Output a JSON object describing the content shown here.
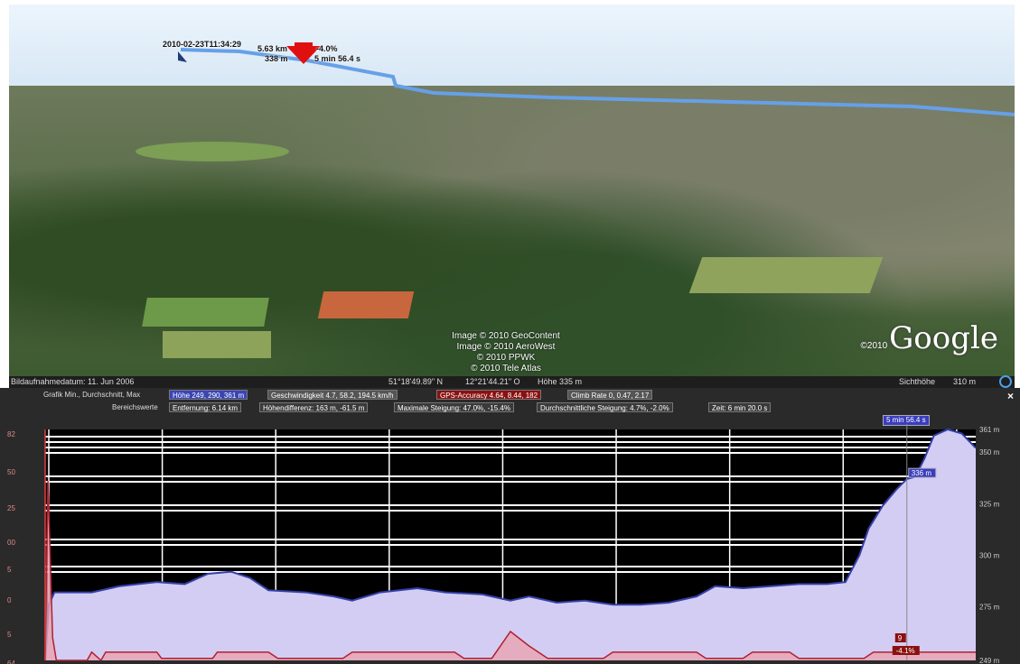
{
  "map": {
    "track_label_time": "2010-02-23T11:34:29",
    "track_label_dist": "5.63 km",
    "track_label_alt": "338 m",
    "track_label_grade": "-4.0%",
    "track_label_dur": "5 min 56.4 s",
    "copyright": [
      "Image © 2010 GeoContent",
      "Image © 2010 AeroWest",
      "© 2010 PPWK",
      "© 2010 Tele Atlas"
    ],
    "brand_year": "©2010",
    "brand": "Google"
  },
  "statusbar": {
    "date": "Bildaufnahmedatum: 11. Jun 2006",
    "lat": "51°18'49.89\" N",
    "lon": "12°21'44.21\" O",
    "alt": "Höhe  335 m",
    "eye_label": "Sichthöhe",
    "eye_value": "310 m"
  },
  "panel": {
    "row1_label": "Grafik  Min., Durchschnitt, Max",
    "chips1": [
      {
        "label": "Höhe  249, 290, 361 m",
        "color": "#3b44b6"
      },
      {
        "label": "Geschwindigkeit  4.7, 58.2, 194.5 km/h",
        "color": "#555555"
      },
      {
        "label": "GPS-Accuracy  4.64, 8.44, 182",
        "color": "#8b1010"
      },
      {
        "label": "Climb Rate  0, 0.47, 2.17",
        "color": "#555555"
      }
    ],
    "row2_label": "Bereichswerte",
    "chips2": [
      "Entfernung: 6.14 km",
      "Höhendifferenz: 163 m, -61.5 m",
      "Maximale Steigung: 47.0%, -15.4%",
      "Durchschnittliche Steigung: 4.7%, -2.0%",
      "Zeit: 6 min 20.0 s"
    ],
    "time_badge": "5 min 56.4 s",
    "close_glyph": "×"
  },
  "chart_data": {
    "type": "area",
    "right_ticks": [
      "361 m",
      "350 m",
      "325 m",
      "300 m",
      "275 m",
      "249 m"
    ],
    "right_tick_values": [
      361,
      350,
      325,
      300,
      275,
      249
    ],
    "left_ticks": [
      "82",
      "50",
      "25",
      "00",
      "5",
      "0",
      "5",
      "64"
    ],
    "ylim": [
      249,
      361
    ],
    "cursor_label": "336 m",
    "cursor_value": 336,
    "cursor_x_fraction": 0.926,
    "grade_label": "-4.1%",
    "grade_marker": "9",
    "elevation": [
      [
        0.0,
        249
      ],
      [
        0.004,
        276
      ],
      [
        0.01,
        282
      ],
      [
        0.05,
        282
      ],
      [
        0.08,
        285
      ],
      [
        0.12,
        287
      ],
      [
        0.15,
        286
      ],
      [
        0.175,
        291
      ],
      [
        0.2,
        292
      ],
      [
        0.22,
        289
      ],
      [
        0.24,
        283
      ],
      [
        0.28,
        282
      ],
      [
        0.31,
        280
      ],
      [
        0.33,
        278
      ],
      [
        0.36,
        282
      ],
      [
        0.4,
        284
      ],
      [
        0.43,
        282
      ],
      [
        0.47,
        281
      ],
      [
        0.5,
        278
      ],
      [
        0.52,
        280
      ],
      [
        0.55,
        277
      ],
      [
        0.58,
        278
      ],
      [
        0.61,
        276
      ],
      [
        0.64,
        276
      ],
      [
        0.67,
        277
      ],
      [
        0.7,
        280
      ],
      [
        0.72,
        285
      ],
      [
        0.75,
        284
      ],
      [
        0.78,
        285
      ],
      [
        0.81,
        286
      ],
      [
        0.84,
        286
      ],
      [
        0.86,
        287
      ],
      [
        0.875,
        300
      ],
      [
        0.885,
        313
      ],
      [
        0.9,
        324
      ],
      [
        0.915,
        332
      ],
      [
        0.926,
        337
      ],
      [
        0.935,
        338
      ],
      [
        0.945,
        347
      ],
      [
        0.955,
        358
      ],
      [
        0.97,
        361
      ],
      [
        0.985,
        359
      ],
      [
        1.0,
        352
      ]
    ],
    "gps_accuracy": [
      [
        0.0,
        249
      ],
      [
        0.003,
        336
      ],
      [
        0.008,
        260
      ],
      [
        0.012,
        249
      ],
      [
        0.045,
        249
      ],
      [
        0.05,
        253
      ],
      [
        0.06,
        249
      ],
      [
        0.065,
        253
      ],
      [
        0.12,
        253
      ],
      [
        0.125,
        250
      ],
      [
        0.18,
        250
      ],
      [
        0.185,
        253
      ],
      [
        0.24,
        253
      ],
      [
        0.25,
        250
      ],
      [
        0.32,
        250
      ],
      [
        0.33,
        253
      ],
      [
        0.44,
        253
      ],
      [
        0.45,
        250
      ],
      [
        0.48,
        250
      ],
      [
        0.5,
        263
      ],
      [
        0.52,
        256
      ],
      [
        0.54,
        250
      ],
      [
        0.6,
        250
      ],
      [
        0.61,
        253
      ],
      [
        0.7,
        253
      ],
      [
        0.71,
        250
      ],
      [
        0.75,
        250
      ],
      [
        0.76,
        253
      ],
      [
        0.8,
        253
      ],
      [
        0.81,
        250
      ],
      [
        0.88,
        250
      ],
      [
        0.89,
        253
      ],
      [
        1.0,
        253
      ]
    ]
  }
}
